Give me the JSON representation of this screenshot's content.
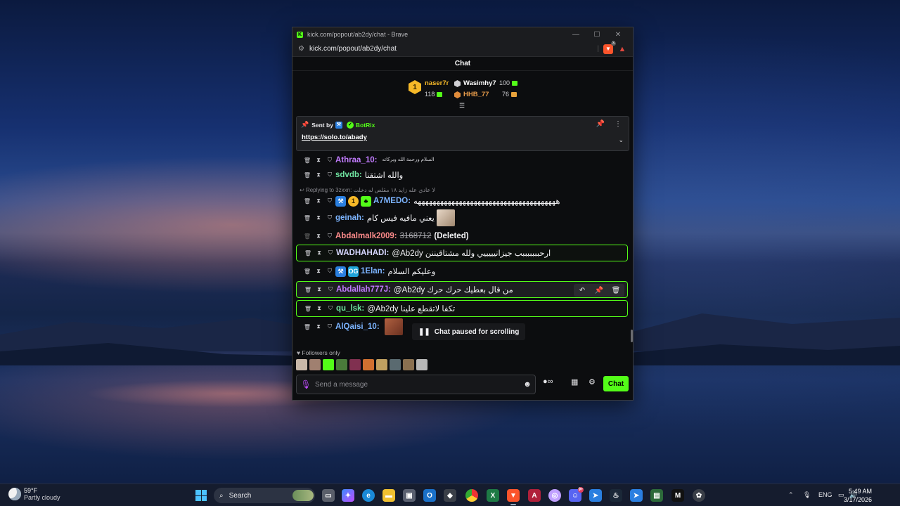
{
  "window": {
    "title": "kick.com/popout/ab2dy/chat - Brave",
    "url": "kick.com/popout/ab2dy/chat",
    "brave_badge": "3"
  },
  "chat": {
    "header": "Chat",
    "leaderboard": [
      {
        "rank": "1",
        "name": "naser7r",
        "value": "118"
      },
      {
        "name": "Wasimhy7",
        "value": "100"
      },
      {
        "name": "HHB_77",
        "value": "76"
      }
    ],
    "pinned": {
      "sent_by": "Sent by",
      "bot": "BotRix",
      "link": "https://solo.to/abady"
    },
    "messages": [
      {
        "user": "Athraa_10:",
        "color": "#c27cff",
        "text_small": "السلام ورحمة الله وبركاته"
      },
      {
        "user": "sdvdb:",
        "color": "#6fe3a0",
        "text": "والله اشتقنا"
      },
      {
        "reply": "Replying to 3zxxn: لا عادي عله زايد ١٨ مقلص له دخلت"
      },
      {
        "user": "A7MEDO:",
        "color": "#7cb4ff",
        "text": "ههههههههههههههههههههههههههههههههههههههه"
      },
      {
        "user": "geinah:",
        "color": "#7cb4ff",
        "text": "يعني مافيه فيس كام"
      },
      {
        "user": "Abdalmalk2009:",
        "color": "#ff8c8c",
        "deleted_value": "3168712",
        "deleted_label": "(Deleted)"
      },
      {
        "user": "WADHAHADI:",
        "color": "#d6d6ff",
        "text": "@Ab2dy ارحبببببببب جيزانيييييي ولله مشتاقيننن"
      },
      {
        "user": "1Elan:",
        "color": "#7cb4ff",
        "text": "وعليكم السلام"
      },
      {
        "user": "Abdallah777J:",
        "color": "#c27cff",
        "text": "@Ab2dy من قال بعطيك حرك حرك"
      },
      {
        "user": "qu_lsk:",
        "color": "#6fe3a0",
        "text": "@Ab2dy تكفا لاتقطع علينا"
      },
      {
        "user": "AlQaisi_10:",
        "color": "#7cb4ff"
      }
    ],
    "paused_label": "Chat paused for scrolling",
    "followers_only": "Followers only",
    "input_placeholder": "Send a message",
    "send_label": "Chat"
  },
  "taskbar": {
    "weather_temp": "59°F",
    "weather_desc": "Partly cloudy",
    "search": "Search",
    "lang": "ENG",
    "time": "5:49 AM",
    "date": "3/17/2026",
    "discord_badge": "9+"
  },
  "colors": {
    "kick_green": "#53fc18",
    "gold": "#f7b928"
  }
}
